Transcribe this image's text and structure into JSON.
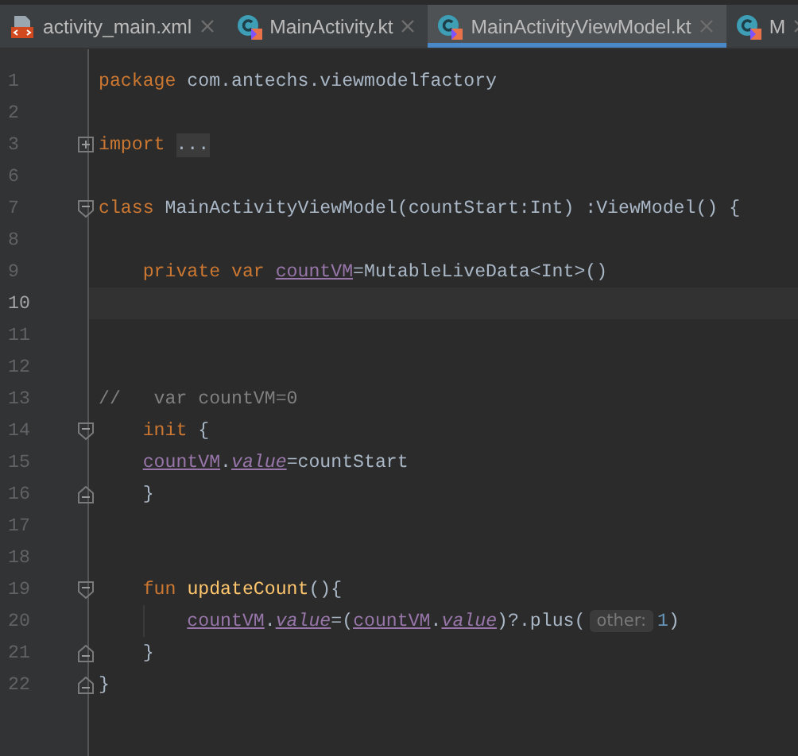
{
  "tabs": [
    {
      "label": "activity_main.xml",
      "kind": "xml",
      "selected": false
    },
    {
      "label": "MainActivity.kt",
      "kind": "kotlin",
      "selected": false
    },
    {
      "label": "MainActivityViewModel.kt",
      "kind": "kotlin",
      "selected": true
    },
    {
      "label": "M",
      "kind": "kotlin",
      "selected": false
    }
  ],
  "editor": {
    "lines": [
      {
        "number": "1",
        "kind": "plain",
        "current": false,
        "tokens": [
          {
            "kind": "keyword",
            "text": "package"
          },
          {
            "kind": "plain",
            "text": " com.antechs.viewmodelfactory"
          }
        ]
      },
      {
        "number": "2",
        "kind": "plain",
        "current": false
      },
      {
        "number": "3",
        "kind": "expand",
        "current": false,
        "tokens": [
          {
            "kind": "keyword",
            "text": "import"
          },
          {
            "kind": "folded",
            "text": " ..."
          }
        ]
      },
      {
        "number": "6",
        "kind": "plain",
        "current": false
      },
      {
        "number": "7",
        "kind": "fold_start",
        "current": false,
        "tokens": [
          {
            "kind": "keyword",
            "text": "class"
          },
          {
            "kind": "plain",
            "text": " MainActivityViewModel(countStart:Int) :ViewModel() {"
          }
        ]
      },
      {
        "number": "8",
        "kind": "plain",
        "current": false
      },
      {
        "number": "9",
        "kind": "plain",
        "current": false,
        "tokens": [
          {
            "kind": "keyword",
            "text": "    private var"
          },
          {
            "kind": "field",
            "text": " countVM"
          },
          {
            "kind": "plain",
            "text": "=MutableLiveData<Int>()"
          }
        ]
      },
      {
        "number": "10",
        "kind": "plain",
        "current": true
      },
      {
        "number": "11",
        "kind": "plain",
        "current": false
      },
      {
        "number": "12",
        "kind": "plain",
        "current": false
      },
      {
        "number": "13",
        "kind": "plain",
        "current": false,
        "tokens": [
          {
            "kind": "comment",
            "text": "//   var countVM=0"
          }
        ]
      },
      {
        "number": "14",
        "kind": "fold_start",
        "current": false,
        "tokens": [
          {
            "kind": "keyword",
            "text": "    init"
          },
          {
            "kind": "plain",
            "text": " {"
          }
        ]
      },
      {
        "number": "15",
        "kind": "plain",
        "current": false,
        "tokens": [
          {
            "kind": "field",
            "text": "    countVM"
          },
          {
            "kind": "plain",
            "text": "."
          },
          {
            "kind": "property",
            "text": "value"
          },
          {
            "kind": "plain",
            "text": "=countStart"
          }
        ]
      },
      {
        "number": "16",
        "kind": "fold_end",
        "current": false,
        "tokens": [
          {
            "kind": "plain",
            "text": "    }"
          }
        ]
      },
      {
        "number": "17",
        "kind": "plain",
        "current": false
      },
      {
        "number": "18",
        "kind": "plain",
        "current": false
      },
      {
        "number": "19",
        "kind": "fold_start",
        "current": false,
        "tokens": [
          {
            "kind": "keyword",
            "text": "    fun"
          },
          {
            "kind": "function",
            "text": " updateCount"
          },
          {
            "kind": "plain",
            "text": "(){"
          }
        ]
      },
      {
        "number": "20",
        "kind": "plain",
        "current": false,
        "guide": true,
        "tokens": [
          {
            "kind": "field",
            "text": "        countVM"
          },
          {
            "kind": "plain",
            "text": "."
          },
          {
            "kind": "property",
            "text": "value"
          },
          {
            "kind": "plain",
            "text": "=("
          },
          {
            "kind": "field",
            "text": "countVM"
          },
          {
            "kind": "plain",
            "text": "."
          },
          {
            "kind": "property",
            "text": "value"
          },
          {
            "kind": "plain",
            "text": ")?.plus("
          },
          {
            "kind": "hint",
            "text": "other:"
          },
          {
            "kind": "number",
            "text": "1"
          },
          {
            "kind": "plain",
            "text": ")"
          }
        ]
      },
      {
        "number": "21",
        "kind": "fold_end",
        "current": false,
        "tokens": [
          {
            "kind": "plain",
            "text": "    }"
          }
        ]
      },
      {
        "number": "22",
        "kind": "fold_end",
        "current": false,
        "tokens": [
          {
            "kind": "plain",
            "text": "}"
          }
        ]
      }
    ]
  }
}
